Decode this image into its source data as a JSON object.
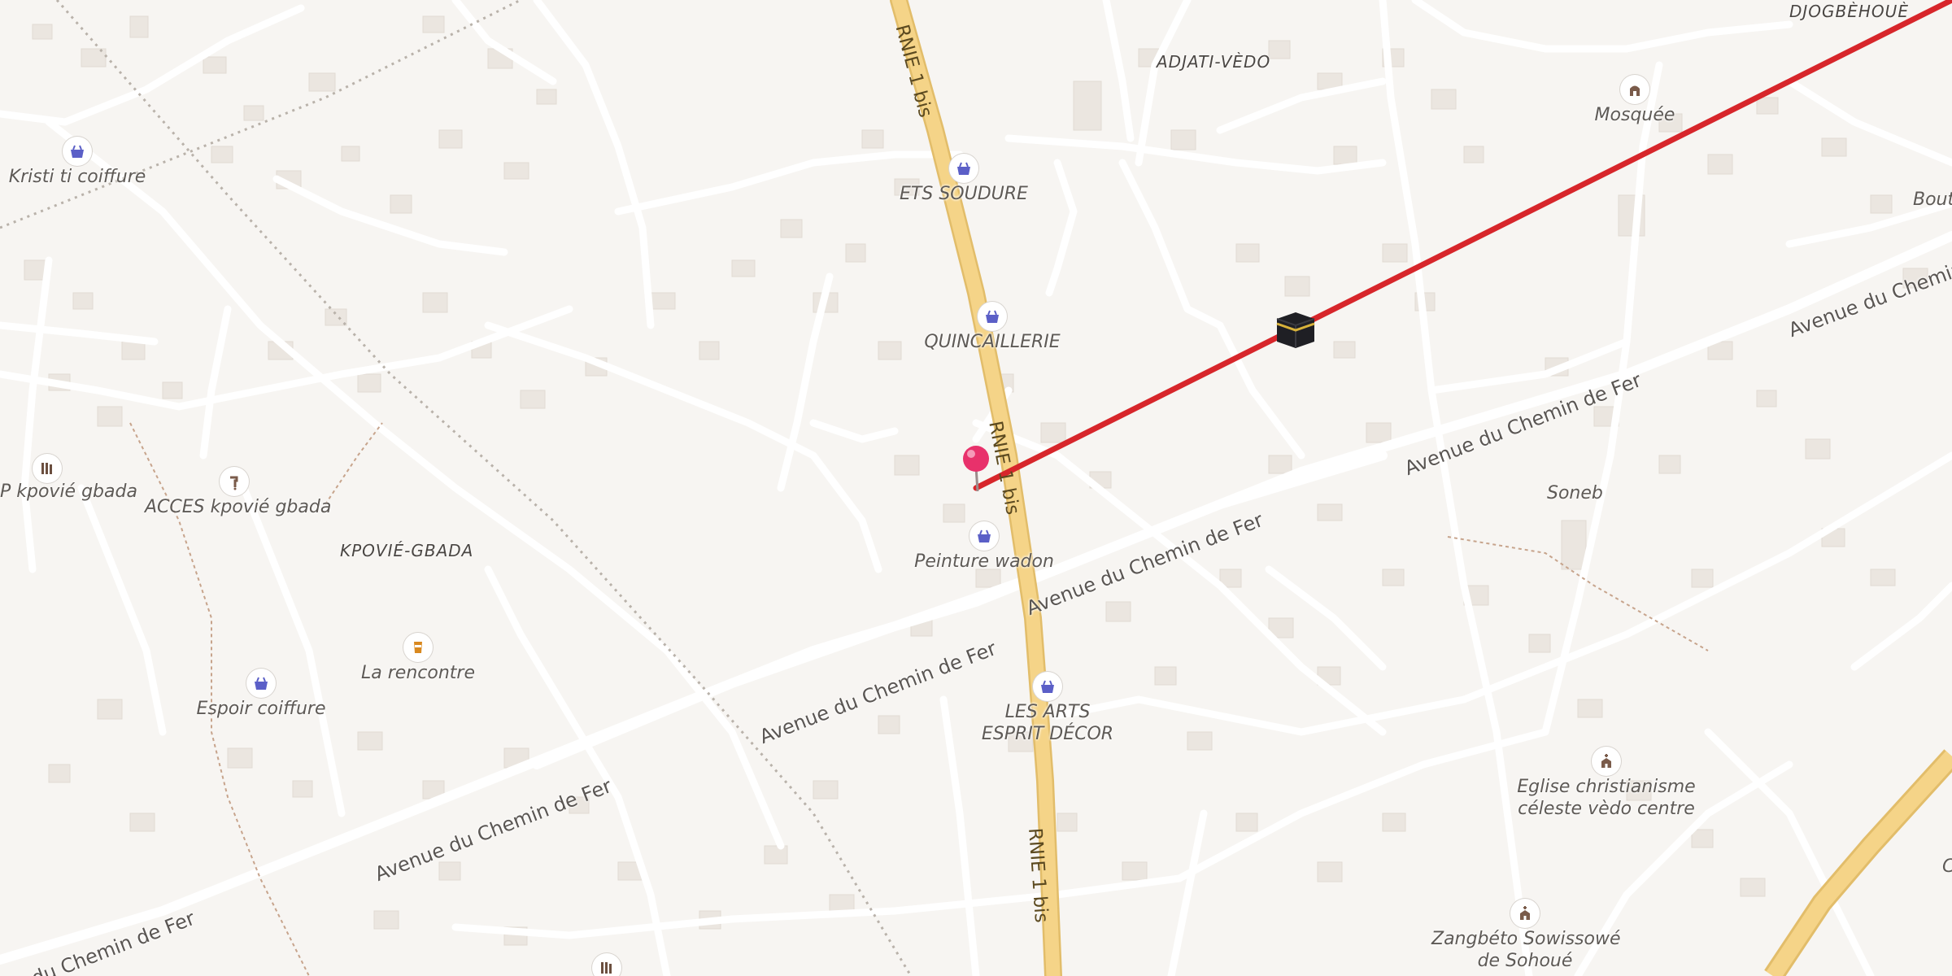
{
  "map": {
    "route_color": "#d7262b",
    "highway_color": "#f5d488",
    "pin_color": "#e8316b",
    "poi_icon_color": "#5b5fc7"
  },
  "places": {
    "djogbehoue": "DJOGBÈHOUÈ",
    "adjati_vedo": "ADJATI-VÈDO",
    "kpovie_gbada": "KPOVIÉ-GBADA",
    "soneb": "Soneb",
    "bouta": "Bouta",
    "c_edge": "C",
    "p_kpovie": "P kpovié gbada"
  },
  "roads": {
    "rnie_1": "RNIE 1 bis",
    "rnie_2": "RNIE 1 bis",
    "rnie_3": "RNIE 1 bis",
    "chemin_1": "Avenue du Chemin de Fer",
    "chemin_2": "Avenue du Chemin de Fer",
    "chemin_3": "Avenue du Chemin de Fer",
    "chemin_4": "Avenue du Chemin de Fer",
    "chemin_5": "Avenue du Chemin de Fer",
    "chemin_6": "du Chemin de Fer"
  },
  "pois": {
    "kristi": {
      "label": "Kristi ti coiffure",
      "icon": "shopping-basket-icon"
    },
    "ets_soudure": {
      "label": "ETS SOUDURE",
      "icon": "shopping-basket-icon"
    },
    "quincaillerie": {
      "label": "QUINCAILLERIE",
      "icon": "shopping-basket-icon"
    },
    "mosquee": {
      "label": "Mosquée",
      "icon": "mosque-icon"
    },
    "acces": {
      "label": "ACCES kpovié gbada",
      "icon": "tap-icon"
    },
    "la_rencontre": {
      "label": "La rencontre",
      "icon": "drink-icon"
    },
    "espoir": {
      "label": "Espoir coiffure",
      "icon": "shopping-basket-icon"
    },
    "peinture": {
      "label": "Peinture wadon",
      "icon": "shopping-basket-icon"
    },
    "les_arts_1": {
      "label": "LES ARTS",
      "icon": "shopping-basket-icon"
    },
    "les_arts_2": {
      "label": "ESPRIT DÉCOR"
    },
    "eglise_1": {
      "label": "Eglise christianisme",
      "icon": "church-icon"
    },
    "eglise_2": {
      "label": "céleste vèdo centre"
    },
    "zangbeto_1": {
      "label": "Zangbéto Sowissowé",
      "icon": "church-icon"
    },
    "zangbeto_2": {
      "label": "de Sohoué"
    }
  },
  "markers": {
    "kaaba": "kaaba-icon",
    "pin": "location-pin-icon"
  }
}
